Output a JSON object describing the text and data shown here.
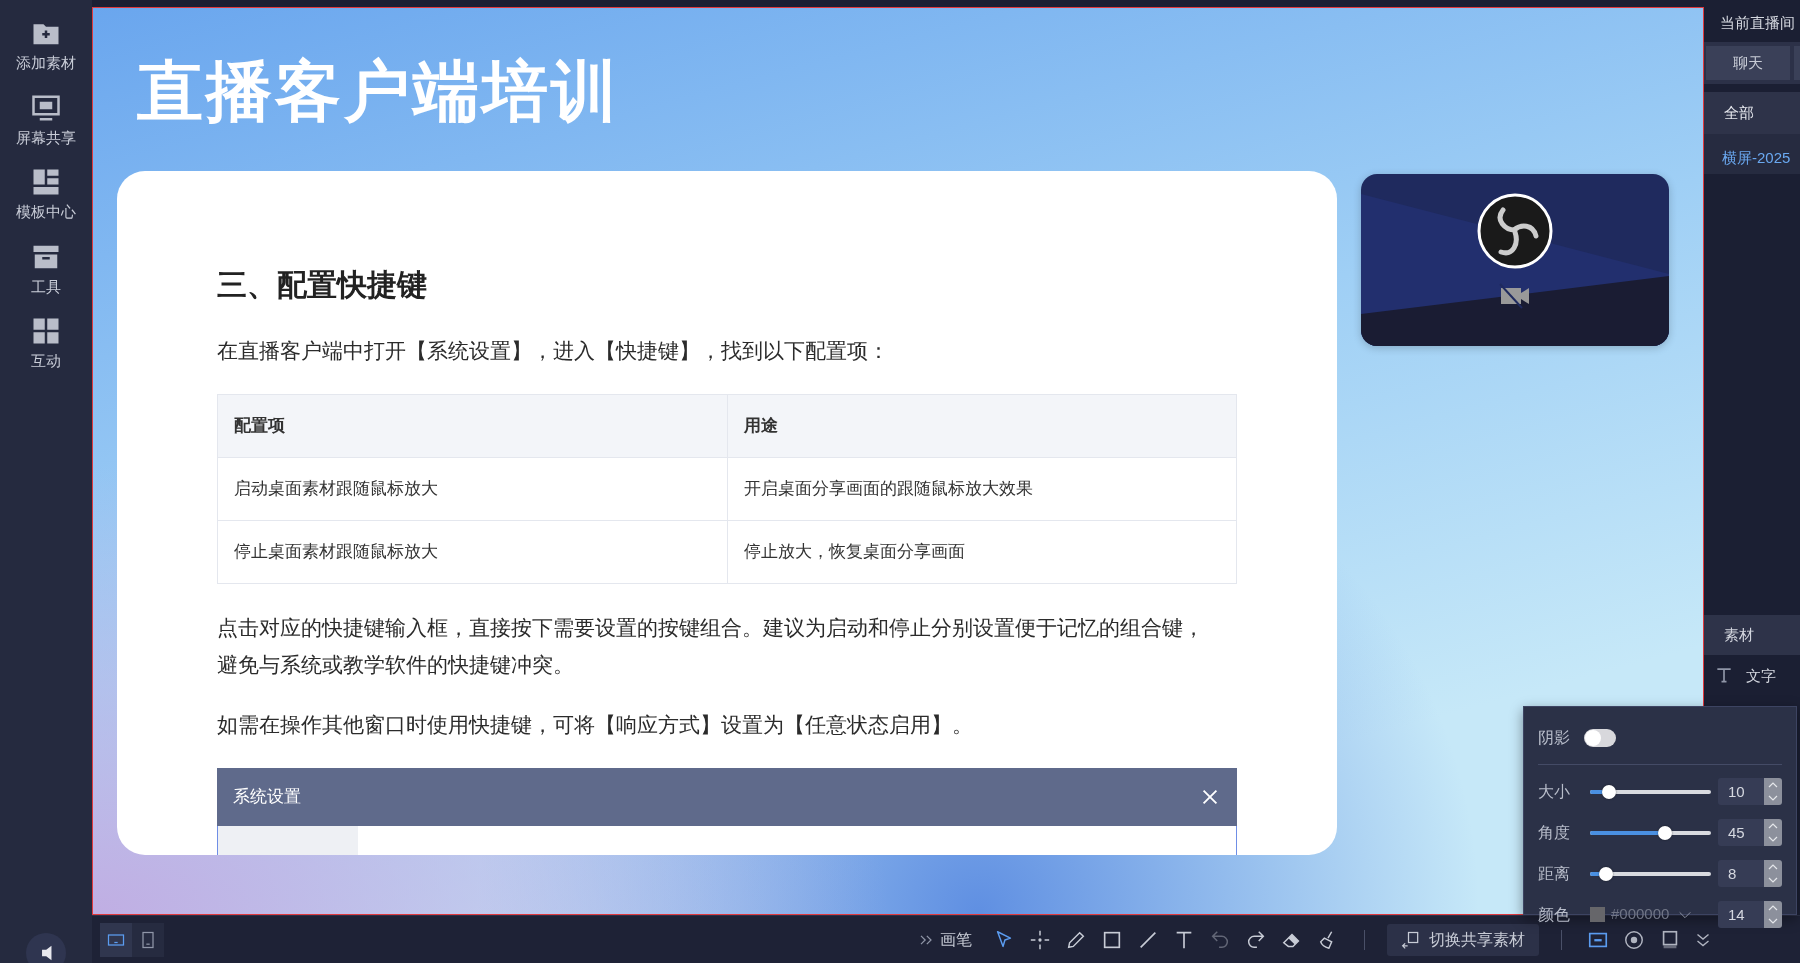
{
  "sidebar": {
    "items": [
      {
        "label": "添加素材"
      },
      {
        "label": "屏幕共享"
      },
      {
        "label": "模板中心"
      },
      {
        "label": "工具"
      },
      {
        "label": "互动"
      }
    ]
  },
  "slide": {
    "title": "直播客户端培训",
    "card": {
      "heading": "三、配置快捷键",
      "intro": "在直播客户端中打开【系统设置】，进入【快捷键】，找到以下配置项：",
      "table": {
        "columns": [
          "配置项",
          "用途"
        ],
        "rows": [
          [
            "启动桌面素材跟随鼠标放大",
            "开启桌面分享画面的跟随鼠标放大效果"
          ],
          [
            "停止桌面素材跟随鼠标放大",
            "停止放大，恢复桌面分享画面"
          ]
        ]
      },
      "notes": [
        "点击对应的快捷键输入框，直接按下需要设置的按键组合。建议为启动和停止分别设置便于记忆的组合键，避免与系统或教学软件的快捷键冲突。",
        "如需在操作其他窗口时使用快捷键，可将【响应方式】设置为【任意状态启用】。"
      ],
      "dialog": {
        "title": "系统设置"
      }
    }
  },
  "right_panel": {
    "title": "当前直播间",
    "tabs": [
      {
        "label": "聊天",
        "selected": true
      }
    ],
    "filter": "全部",
    "rooms": [
      {
        "label": "横屏-2025",
        "selected": true
      }
    ],
    "materials_title": "素材",
    "materials": [
      {
        "label": "文字"
      }
    ]
  },
  "shadow_popup": {
    "toggle": {
      "label": "阴影",
      "on": false
    },
    "sliders": [
      {
        "label": "大小",
        "level": 0.15,
        "value": "10"
      },
      {
        "label": "角度",
        "level": 0.61,
        "value": "45"
      },
      {
        "label": "距离",
        "level": 0.13,
        "value": "8"
      }
    ],
    "color": {
      "label": "颜色",
      "value": "#000000",
      "size": "14"
    }
  },
  "bottom_bar": {
    "views": [
      {
        "selected": true
      },
      {
        "selected": false
      }
    ],
    "pen_label": "画笔",
    "tools": [
      {
        "selected": true,
        "disabled": false
      },
      {
        "selected": false,
        "disabled": false
      },
      {
        "selected": false,
        "disabled": false
      },
      {
        "selected": false,
        "disabled": false
      },
      {
        "selected": false,
        "disabled": false
      },
      {
        "selected": false,
        "disabled": false
      },
      {
        "selected": false,
        "disabled": true
      },
      {
        "selected": false,
        "disabled": false
      },
      {
        "selected": false,
        "disabled": false
      },
      {
        "selected": false,
        "disabled": false
      }
    ],
    "switch_button": "切换共享素材",
    "layouts": [
      {
        "selected": true
      },
      {
        "selected": false
      },
      {
        "selected": false
      }
    ]
  }
}
